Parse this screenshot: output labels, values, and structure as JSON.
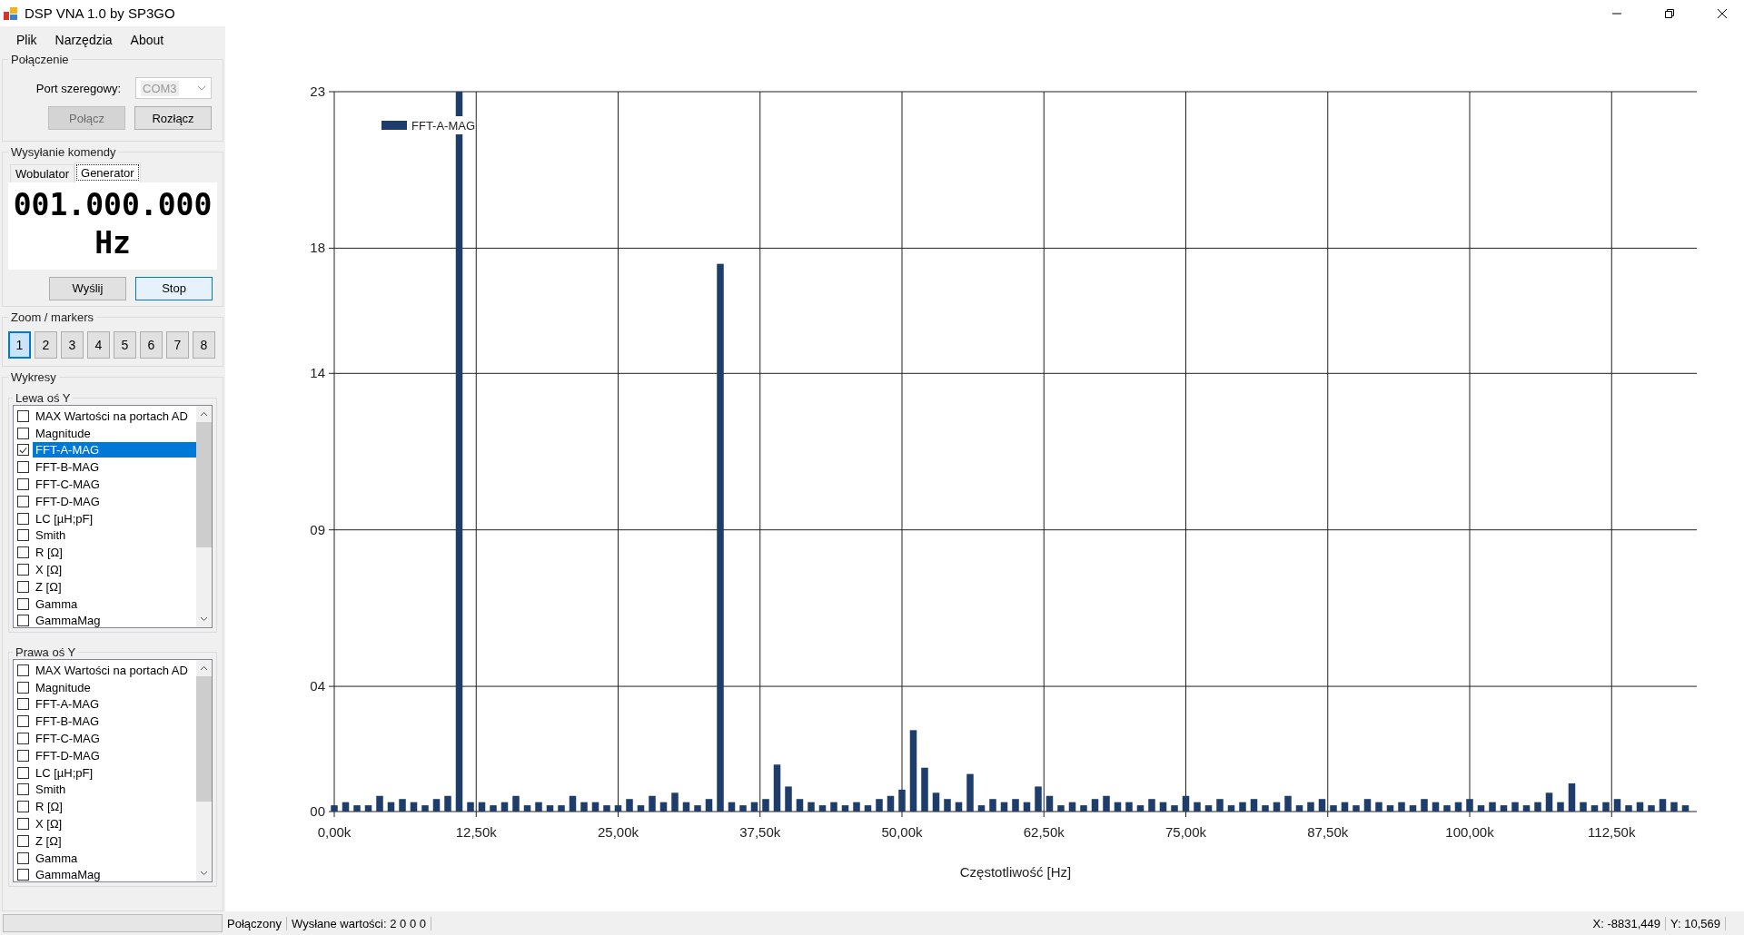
{
  "window": {
    "title": "DSP VNA 1.0 by SP3GO"
  },
  "menu": [
    "Plik",
    "Narzędzia",
    "About"
  ],
  "connection": {
    "title": "Połączenie",
    "port_label": "Port szeregowy:",
    "port_value": "COM3",
    "port_disabled": true,
    "buttons": [
      {
        "label": "Połącz",
        "disabled": true
      },
      {
        "label": "Rozłącz",
        "disabled": false
      }
    ]
  },
  "command": {
    "title": "Wysyłanie komendy",
    "tabs": [
      {
        "label": "Wobulator",
        "selected": false
      },
      {
        "label": "Generator",
        "selected": true
      }
    ],
    "frequency": "001.000.000",
    "unit": "Hz",
    "buttons": [
      {
        "label": "Wyślij",
        "selected": false
      },
      {
        "label": "Stop",
        "selected": true
      }
    ]
  },
  "zoom": {
    "title": "Zoom / markers",
    "buttons": [
      {
        "label": "1",
        "selected": true
      },
      {
        "label": "2",
        "selected": false
      },
      {
        "label": "3",
        "selected": false
      },
      {
        "label": "4",
        "selected": false
      },
      {
        "label": "5",
        "selected": false
      },
      {
        "label": "6",
        "selected": false
      },
      {
        "label": "7",
        "selected": false
      },
      {
        "label": "8",
        "selected": false
      }
    ]
  },
  "plots": {
    "title": "Wykresy",
    "groups": [
      {
        "title": "Lewa oś Y",
        "items": [
          {
            "label": "MAX Wartości na portach AD",
            "checked": false,
            "selected": false
          },
          {
            "label": "Magnitude",
            "checked": false,
            "selected": false
          },
          {
            "label": "FFT-A-MAG",
            "checked": true,
            "selected": true
          },
          {
            "label": "FFT-B-MAG",
            "checked": false,
            "selected": false
          },
          {
            "label": "FFT-C-MAG",
            "checked": false,
            "selected": false
          },
          {
            "label": "FFT-D-MAG",
            "checked": false,
            "selected": false
          },
          {
            "label": "LC [µH;pF]",
            "checked": false,
            "selected": false
          },
          {
            "label": "Smith",
            "checked": false,
            "selected": false
          },
          {
            "label": "R [Ω]",
            "checked": false,
            "selected": false
          },
          {
            "label": "X [Ω]",
            "checked": false,
            "selected": false
          },
          {
            "label": "Z [Ω]",
            "checked": false,
            "selected": false
          },
          {
            "label": "Gamma",
            "checked": false,
            "selected": false
          },
          {
            "label": "GammaMag",
            "checked": false,
            "selected": false
          }
        ]
      },
      {
        "title": "Prawa oś Y",
        "items": [
          {
            "label": "MAX Wartości na portach AD",
            "checked": false,
            "selected": false
          },
          {
            "label": "Magnitude",
            "checked": false,
            "selected": false
          },
          {
            "label": "FFT-A-MAG",
            "checked": false,
            "selected": false
          },
          {
            "label": "FFT-B-MAG",
            "checked": false,
            "selected": false
          },
          {
            "label": "FFT-C-MAG",
            "checked": false,
            "selected": false
          },
          {
            "label": "FFT-D-MAG",
            "checked": false,
            "selected": false
          },
          {
            "label": "LC [µH;pF]",
            "checked": false,
            "selected": false
          },
          {
            "label": "Smith",
            "checked": false,
            "selected": false
          },
          {
            "label": "R [Ω]",
            "checked": false,
            "selected": false
          },
          {
            "label": "X [Ω]",
            "checked": false,
            "selected": false
          },
          {
            "label": "Z [Ω]",
            "checked": false,
            "selected": false
          },
          {
            "label": "Gamma",
            "checked": false,
            "selected": false
          },
          {
            "label": "GammaMag",
            "checked": false,
            "selected": false
          }
        ]
      }
    ]
  },
  "chart": {
    "chart_data": {
      "type": "bar",
      "xlabel": "Częstotliwość [Hz]",
      "x": [
        0,
        1000,
        2000,
        3000,
        4000,
        5000,
        6000,
        7000,
        8000,
        9000,
        10000,
        11000,
        12000,
        13000,
        14000,
        15000,
        16000,
        17000,
        18000,
        19000,
        20000,
        21000,
        22000,
        23000,
        24000,
        25000,
        26000,
        27000,
        28000,
        29000,
        30000,
        31000,
        32000,
        33000,
        34000,
        35000,
        36000,
        37000,
        38000,
        39000,
        40000,
        41000,
        42000,
        43000,
        44000,
        45000,
        46000,
        47000,
        48000,
        49000,
        50000,
        51000,
        52000,
        53000,
        54000,
        55000,
        56000,
        57000,
        58000,
        59000,
        60000,
        61000,
        62000,
        63000,
        64000,
        65000,
        66000,
        67000,
        68000,
        69000,
        70000,
        71000,
        72000,
        73000,
        74000,
        75000,
        76000,
        77000,
        78000,
        79000,
        80000,
        81000,
        82000,
        83000,
        84000,
        85000,
        86000,
        87000,
        88000,
        89000,
        90000,
        91000,
        92000,
        93000,
        94000,
        95000,
        96000,
        97000,
        98000,
        99000,
        100000,
        101000,
        102000,
        103000,
        104000,
        105000,
        106000,
        107000,
        108000,
        109000,
        110000,
        111000,
        112000,
        113000,
        114000,
        115000,
        116000,
        117000,
        118000,
        119000
      ],
      "series": [
        {
          "name": "FFT-A-MAG",
          "color": "#1f3d6b",
          "values": [
            0.2,
            0.3,
            0.2,
            0.2,
            0.5,
            0.3,
            0.4,
            0.3,
            0.2,
            0.4,
            0.5,
            23,
            0.3,
            0.3,
            0.2,
            0.3,
            0.5,
            0.2,
            0.3,
            0.2,
            0.2,
            0.5,
            0.3,
            0.3,
            0.2,
            0.2,
            0.4,
            0.2,
            0.5,
            0.3,
            0.6,
            0.3,
            0.2,
            0.4,
            17.5,
            0.3,
            0.2,
            0.3,
            0.4,
            1.5,
            0.8,
            0.4,
            0.3,
            0.2,
            0.3,
            0.2,
            0.3,
            0.2,
            0.4,
            0.5,
            0.7,
            2.6,
            1.4,
            0.6,
            0.4,
            0.3,
            1.2,
            0.2,
            0.4,
            0.3,
            0.4,
            0.3,
            0.8,
            0.5,
            0.2,
            0.3,
            0.2,
            0.4,
            0.5,
            0.3,
            0.3,
            0.2,
            0.4,
            0.3,
            0.2,
            0.5,
            0.3,
            0.2,
            0.4,
            0.2,
            0.3,
            0.4,
            0.2,
            0.3,
            0.5,
            0.2,
            0.3,
            0.4,
            0.2,
            0.3,
            0.2,
            0.4,
            0.3,
            0.2,
            0.3,
            0.2,
            0.4,
            0.3,
            0.2,
            0.3,
            0.4,
            0.2,
            0.3,
            0.2,
            0.3,
            0.2,
            0.3,
            0.6,
            0.3,
            0.9,
            0.3,
            0.2,
            0.3,
            0.4,
            0.2,
            0.3,
            0.2,
            0.4,
            0.3,
            0.2
          ]
        }
      ],
      "xlim": [
        0,
        120000
      ],
      "ylim": [
        0,
        23
      ],
      "xticks": [
        {
          "value": 0,
          "label": "0,00k"
        },
        {
          "value": 12500,
          "label": "12,50k"
        },
        {
          "value": 25000,
          "label": "25,00k"
        },
        {
          "value": 37500,
          "label": "37,50k"
        },
        {
          "value": 50000,
          "label": "50,00k"
        },
        {
          "value": 62500,
          "label": "62,50k"
        },
        {
          "value": 75000,
          "label": "75,00k"
        },
        {
          "value": 87500,
          "label": "87,50k"
        },
        {
          "value": 100000,
          "label": "100,00k"
        },
        {
          "value": 112500,
          "label": "112,50k"
        }
      ],
      "yticks": [
        {
          "value": 0,
          "label": "00"
        },
        {
          "value": 4,
          "label": "04"
        },
        {
          "value": 9,
          "label": "09"
        },
        {
          "value": 14,
          "label": "14"
        },
        {
          "value": 18,
          "label": "18"
        },
        {
          "value": 23,
          "label": "23"
        }
      ],
      "grid": true
    }
  },
  "status_bar": {
    "status": "Połączony",
    "sent": "Wysłane wartości: 2 0 0 0",
    "x": "X: -8831,449",
    "y": "Y: 10,569"
  }
}
